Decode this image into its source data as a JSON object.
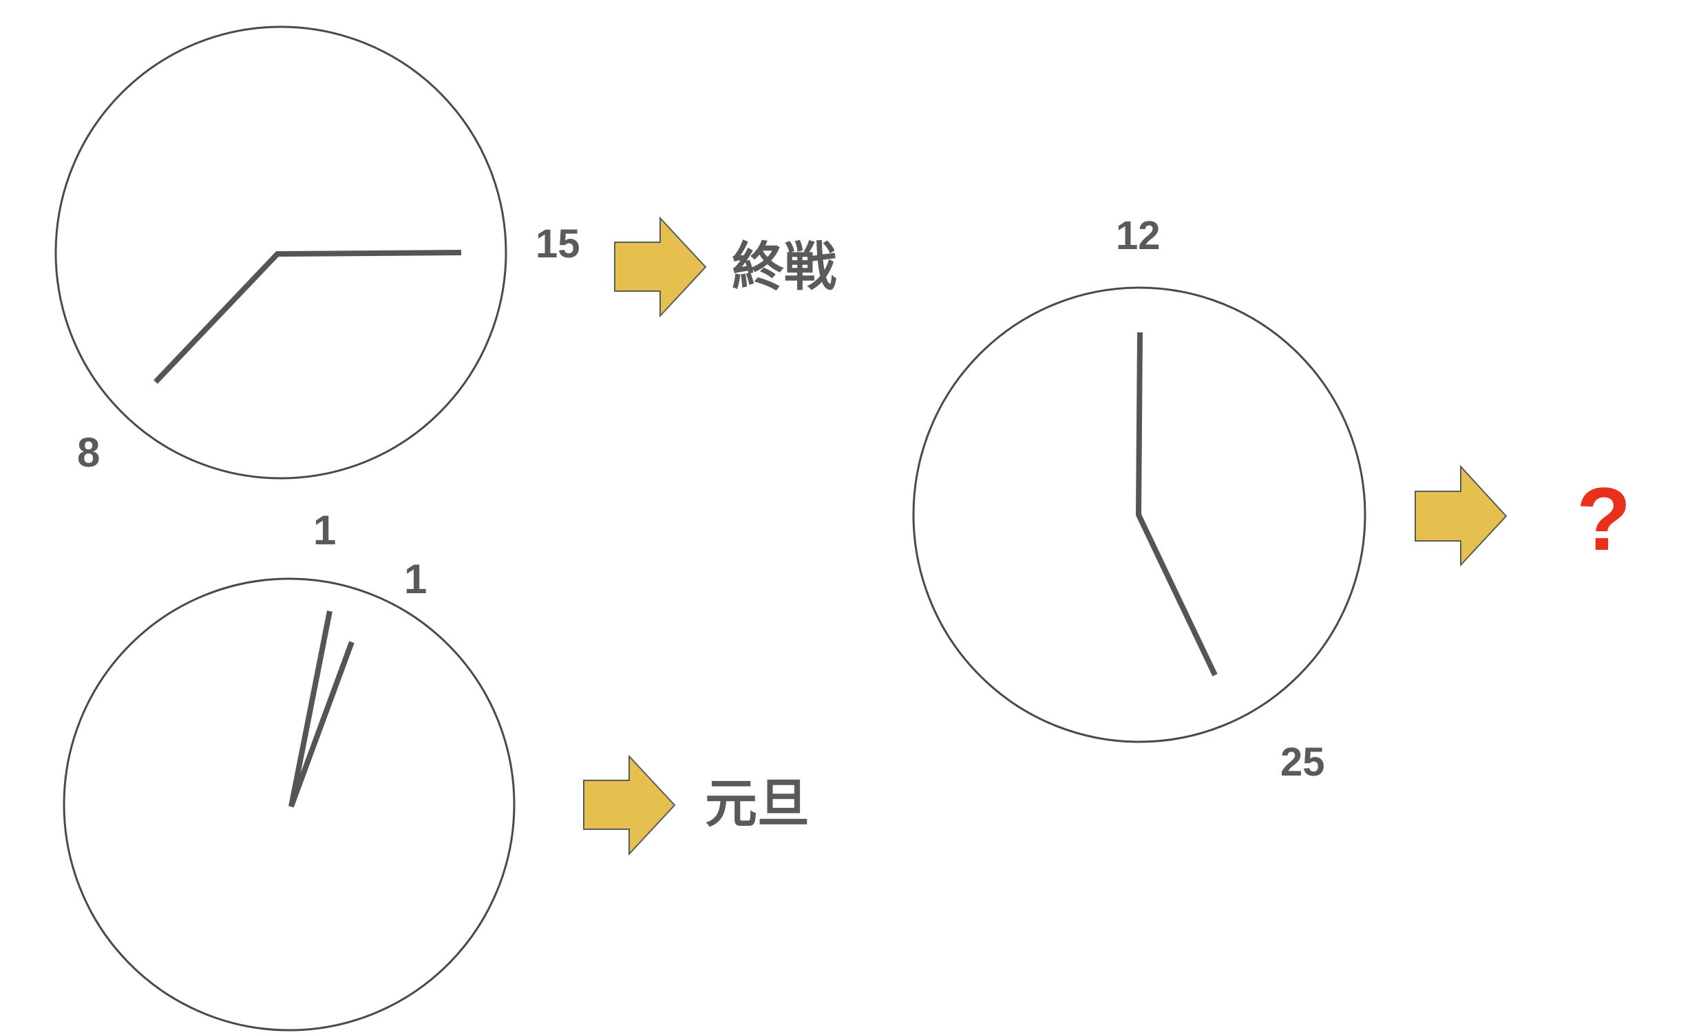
{
  "clocks": [
    {
      "hour_label": "8",
      "minute_label": "15",
      "meaning": "終戦"
    },
    {
      "hour_label": "1",
      "minute_label": "1",
      "meaning": "元旦"
    },
    {
      "hour_label": "12",
      "minute_label": "25",
      "meaning": "?"
    }
  ],
  "colors": {
    "hand": "#555555",
    "face_stroke": "#4a4a4a",
    "arrow_fill": "#e6c04e",
    "text": "#5a5a5a",
    "question": "#e8301c"
  },
  "icons": [
    "arrow-right-icon"
  ]
}
